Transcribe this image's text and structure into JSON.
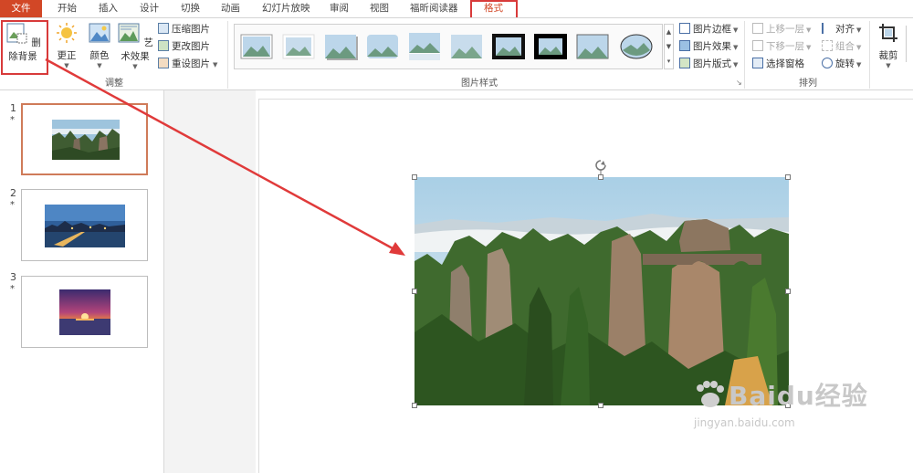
{
  "tabs": {
    "file": "文件",
    "home": "开始",
    "insert": "插入",
    "design": "设计",
    "transitions": "切换",
    "animations": "动画",
    "slideshow": "幻灯片放映",
    "review": "审阅",
    "view": "视图",
    "foxit": "福昕阅读器",
    "format": "格式"
  },
  "ribbon": {
    "remove_background": "删除背景",
    "corrections": "更正",
    "color": "颜色",
    "artistic_effects": "艺术效果",
    "compress_pictures": "压缩图片",
    "change_picture": "更改图片",
    "reset_picture": "重设图片",
    "group_adjust": "调整",
    "group_picture_styles": "图片样式",
    "picture_border": "图片边框",
    "picture_effects": "图片效果",
    "picture_layout": "图片版式",
    "bring_forward": "上移一层",
    "send_backward": "下移一层",
    "selection_pane": "选择窗格",
    "align": "对齐",
    "group": "组合",
    "rotate": "旋转",
    "group_arrange": "排列",
    "crop": "裁剪"
  },
  "slides": [
    {
      "number": "1",
      "mark": "*"
    },
    {
      "number": "2",
      "mark": "*"
    },
    {
      "number": "3",
      "mark": "*"
    }
  ],
  "watermark": {
    "brand": "Baidu经验",
    "url": "jingyan.baidu.com"
  },
  "colors": {
    "accent": "#d24726",
    "annotation": "#e03a3a",
    "selected_thumb": "#cf7b59"
  }
}
